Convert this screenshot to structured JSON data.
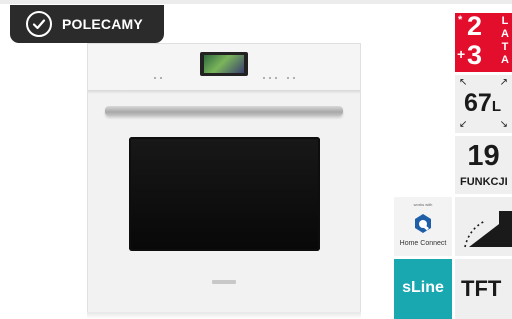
{
  "badge": {
    "label": "POLECAMY",
    "icon": "checkmark-circle-icon"
  },
  "product": {
    "image": "oven-product-image"
  },
  "features": {
    "guarantee": {
      "star": "*",
      "plus": "+",
      "base_years": "2",
      "extra_years": "3",
      "unit": "LATA",
      "color": "#e30d2c"
    },
    "capacity": {
      "value": "67",
      "unit": "L",
      "icon": "expand-arrows-icon"
    },
    "functions": {
      "value": "19",
      "label": "FUNKCJI"
    },
    "home_connect": {
      "works_with": "works with",
      "label": "Home Connect",
      "icon": "home-connect-icon"
    },
    "door": {
      "icon": "door-opening-icon"
    },
    "sline": {
      "label": "sLine",
      "color": "#19a7b0"
    },
    "display": {
      "label": "TFT"
    }
  }
}
